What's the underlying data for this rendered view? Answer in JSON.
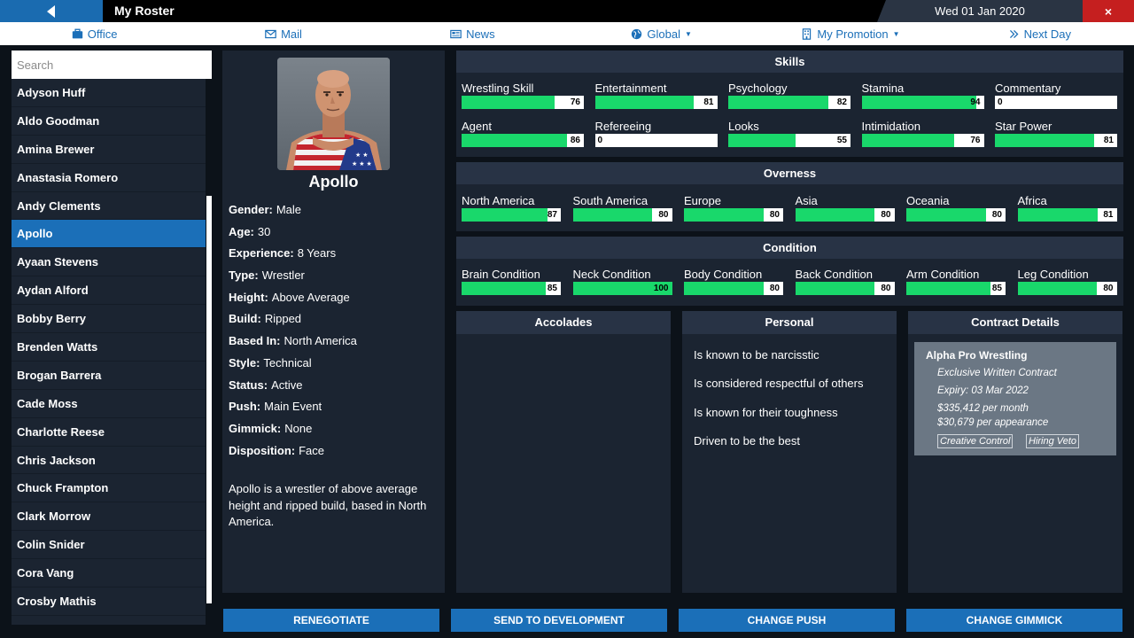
{
  "header": {
    "title": "My Roster",
    "date": "Wed 01 Jan 2020",
    "close_label": "×"
  },
  "nav": [
    {
      "label": "Office",
      "icon": "briefcase-icon"
    },
    {
      "label": "Mail",
      "icon": "envelope-icon"
    },
    {
      "label": "News",
      "icon": "newspaper-icon"
    },
    {
      "label": "Global",
      "icon": "globe-icon",
      "dropdown": true
    },
    {
      "label": "My Promotion",
      "icon": "building-icon",
      "dropdown": true
    },
    {
      "label": "Next Day",
      "icon": "double-chevron-icon"
    }
  ],
  "search": {
    "placeholder": "Search"
  },
  "roster": [
    "Adyson Huff",
    "Aldo Goodman",
    "Amina Brewer",
    "Anastasia Romero",
    "Andy Clements",
    "Apollo",
    "Ayaan Stevens",
    "Aydan Alford",
    "Bobby Berry",
    "Brenden Watts",
    "Brogan Barrera",
    "Cade Moss",
    "Charlotte Reese",
    "Chris Jackson",
    "Chuck Frampton",
    "Clark Morrow",
    "Colin Snider",
    "Cora Vang",
    "Crosby Mathis"
  ],
  "selected_index": 5,
  "profile": {
    "name": "Apollo",
    "fields": [
      {
        "label": "Gender:",
        "value": "Male"
      },
      {
        "label": "Age:",
        "value": "30"
      },
      {
        "label": "Experience:",
        "value": "8 Years"
      },
      {
        "label": "Type:",
        "value": "Wrestler"
      },
      {
        "label": "Height:",
        "value": "Above Average"
      },
      {
        "label": "Build:",
        "value": "Ripped"
      },
      {
        "label": "Based In:",
        "value": "North America"
      },
      {
        "label": "Style:",
        "value": "Technical"
      },
      {
        "label": "Status:",
        "value": "Active"
      },
      {
        "label": "Push:",
        "value": "Main Event"
      },
      {
        "label": "Gimmick:",
        "value": "None"
      },
      {
        "label": "Disposition:",
        "value": "Face"
      }
    ],
    "bio": "Apollo is a wrestler of above average height and ripped build, based in North America."
  },
  "skills": {
    "title": "Skills",
    "items": [
      {
        "label": "Wrestling Skill",
        "value": 76
      },
      {
        "label": "Entertainment",
        "value": 81
      },
      {
        "label": "Psychology",
        "value": 82
      },
      {
        "label": "Stamina",
        "value": 94
      },
      {
        "label": "Commentary",
        "value": 0
      },
      {
        "label": "Agent",
        "value": 86
      },
      {
        "label": "Refereeing",
        "value": 0
      },
      {
        "label": "Looks",
        "value": 55
      },
      {
        "label": "Intimidation",
        "value": 76
      },
      {
        "label": "Star Power",
        "value": 81
      }
    ]
  },
  "overness": {
    "title": "Overness",
    "items": [
      {
        "label": "North America",
        "value": 87
      },
      {
        "label": "South America",
        "value": 80
      },
      {
        "label": "Europe",
        "value": 80
      },
      {
        "label": "Asia",
        "value": 80
      },
      {
        "label": "Oceania",
        "value": 80
      },
      {
        "label": "Africa",
        "value": 81
      }
    ]
  },
  "condition": {
    "title": "Condition",
    "items": [
      {
        "label": "Brain Condition",
        "value": 85
      },
      {
        "label": "Neck Condition",
        "value": 100
      },
      {
        "label": "Body Condition",
        "value": 80
      },
      {
        "label": "Back Condition",
        "value": 80
      },
      {
        "label": "Arm Condition",
        "value": 85
      },
      {
        "label": "Leg Condition",
        "value": 80
      }
    ]
  },
  "accolades": {
    "title": "Accolades"
  },
  "personal": {
    "title": "Personal",
    "items": [
      "Is known to be narcisstic",
      "Is considered respectful of others",
      "Is known for their toughness",
      "Driven to be the best"
    ]
  },
  "contract": {
    "title": "Contract Details",
    "company": "Alpha Pro Wrestling",
    "type": "Exclusive Written Contract",
    "expiry": "Expiry: 03 Mar 2022",
    "monthly": "$335,412 per month",
    "appearance": "$30,679 per appearance",
    "tags": [
      "Creative Control",
      "Hiring Veto"
    ]
  },
  "actions": [
    "RENEGOTIATE",
    "SEND TO DEVELOPMENT",
    "CHANGE PUSH",
    "CHANGE GIMMICK"
  ],
  "colors": {
    "accent": "#1b6fb8",
    "bar_fill": "#19d86b",
    "close": "#c51f1f",
    "panel": "#1b2431",
    "panel_head": "#283345"
  }
}
